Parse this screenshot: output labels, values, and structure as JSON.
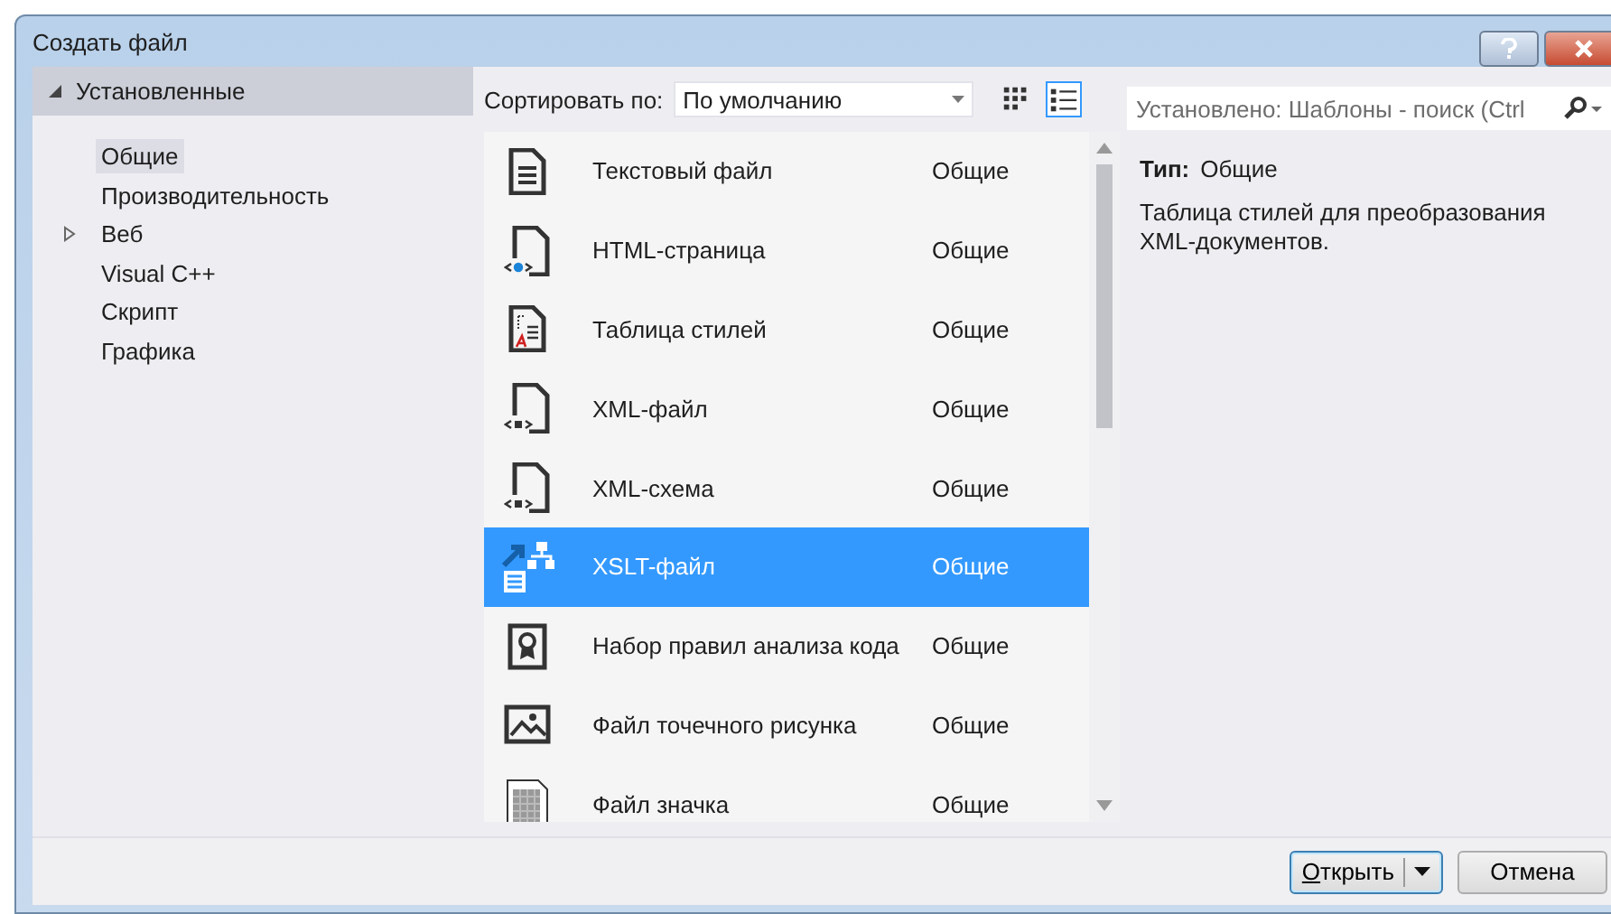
{
  "window": {
    "title": "Создать файл"
  },
  "tree": {
    "label": "Установленные",
    "expanded": true,
    "children": [
      {
        "label": "Общие",
        "selected": true
      },
      {
        "label": "Производительность",
        "selected": false
      },
      {
        "label": "Веб",
        "selected": false,
        "expanded": false
      },
      {
        "label": "Visual C++",
        "selected": false
      },
      {
        "label": "Скрипт",
        "selected": false
      },
      {
        "label": "Графика",
        "selected": false
      }
    ]
  },
  "sort": {
    "label": "Сортировать по:",
    "value": "По умолчанию"
  },
  "view_buttons": [
    {
      "kind": "grid",
      "selected": false
    },
    {
      "kind": "list",
      "selected": true
    }
  ],
  "search": {
    "placeholder": "Установлено: Шаблоны - поиск (Ctrl"
  },
  "templates": [
    {
      "kind": "text",
      "name": "Текстовый файл",
      "category": "Общие",
      "selected": false
    },
    {
      "kind": "html",
      "name": "HTML-страница",
      "category": "Общие",
      "selected": false
    },
    {
      "kind": "stylesheet",
      "name": "Таблица стилей",
      "category": "Общие",
      "selected": false
    },
    {
      "kind": "xml",
      "name": "XML-файл",
      "category": "Общие",
      "selected": false
    },
    {
      "kind": "xml",
      "name": "XML-схема",
      "category": "Общие",
      "selected": false
    },
    {
      "kind": "xslt",
      "name": "XSLT-файл",
      "category": "Общие",
      "selected": true
    },
    {
      "kind": "ruleset",
      "name": "Набор правил анализа кода",
      "category": "Общие",
      "selected": false
    },
    {
      "kind": "bitmap",
      "name": "Файл точечного рисунка",
      "category": "Общие",
      "selected": false
    },
    {
      "kind": "icon",
      "name": "Файл значка",
      "category": "Общие",
      "selected": false
    }
  ],
  "details": {
    "type_label": "Тип:",
    "type_value": "Общие",
    "description": "Таблица стилей для преобразования XML-документов."
  },
  "buttons": [
    {
      "kind": "split",
      "label": "Открыть"
    },
    {
      "kind": "plain",
      "label": "Отмена"
    }
  ]
}
